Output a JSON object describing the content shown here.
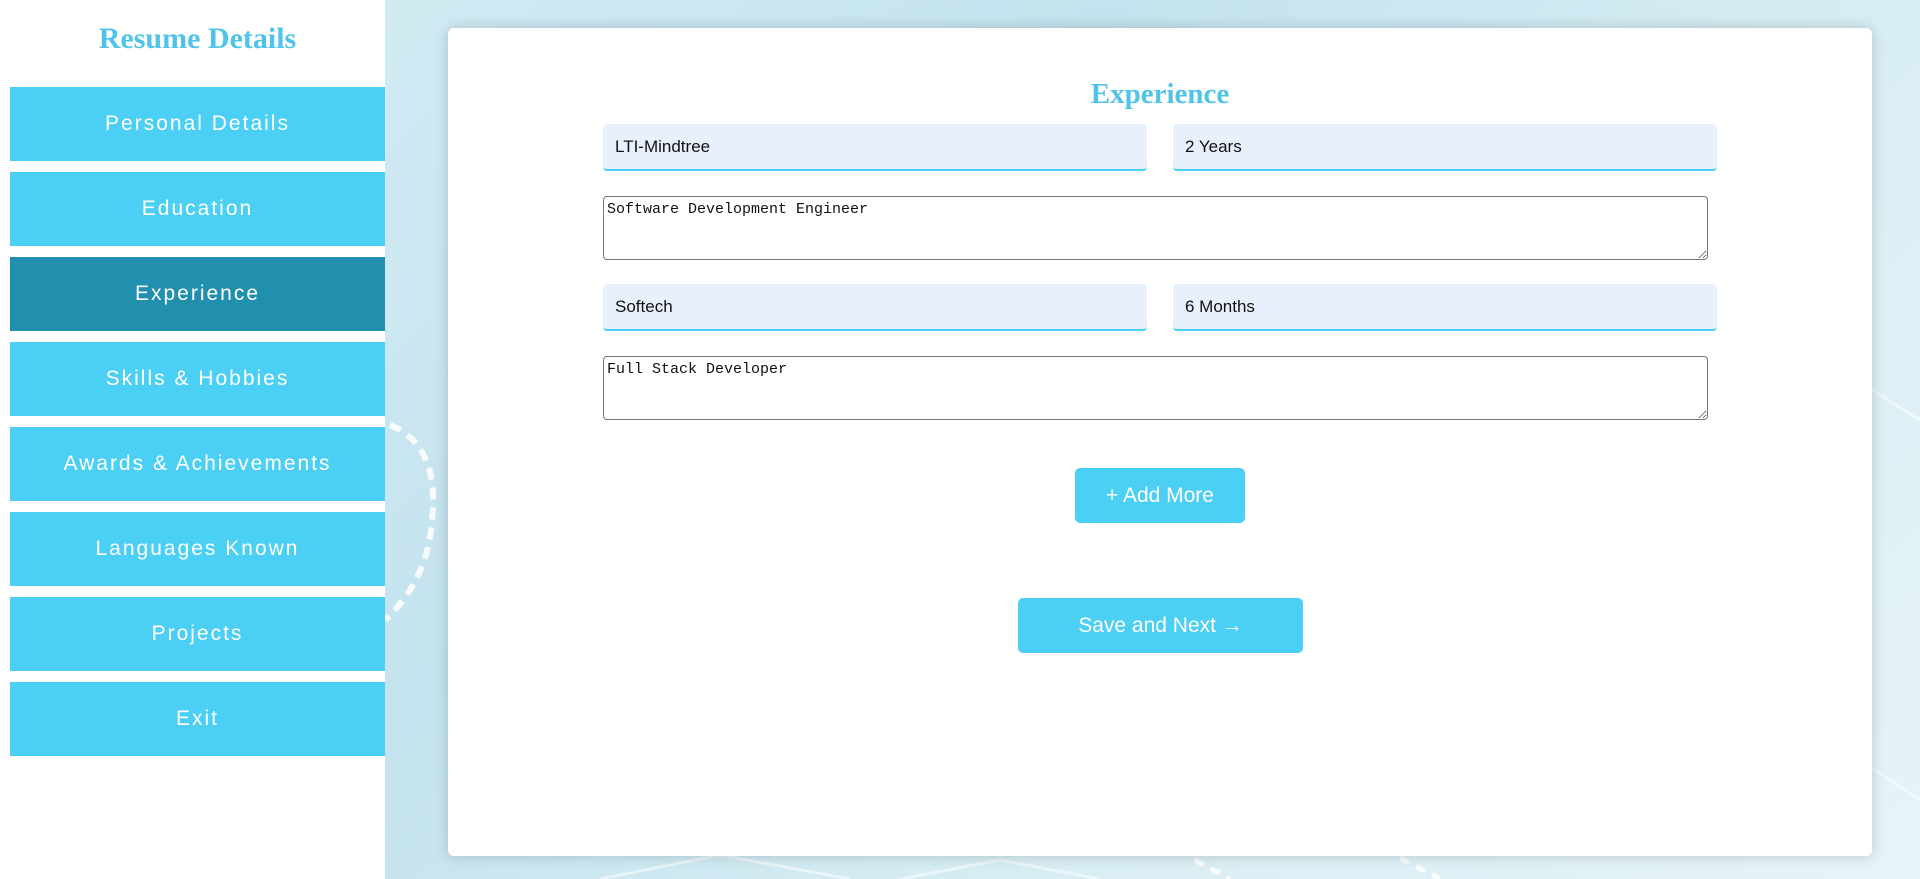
{
  "sidebar": {
    "title": "Resume Details",
    "items": [
      {
        "label": "Personal Details",
        "active": false
      },
      {
        "label": "Education",
        "active": false
      },
      {
        "label": "Experience",
        "active": true
      },
      {
        "label": "Skills & Hobbies",
        "active": false
      },
      {
        "label": "Awards & Achievements",
        "active": false
      },
      {
        "label": "Languages Known",
        "active": false
      },
      {
        "label": "Projects",
        "active": false
      },
      {
        "label": "Exit",
        "active": false
      }
    ]
  },
  "main": {
    "title": "Experience",
    "entries": [
      {
        "company": "LTI-Mindtree",
        "duration": "2 Years",
        "role": "Software Development Engineer"
      },
      {
        "company": "Softech",
        "duration": "6 Months",
        "role": "Full Stack Developer"
      }
    ],
    "add_more_label": "+ Add More",
    "save_next_label": "Save and Next →"
  },
  "colors": {
    "accent": "#4ccff4",
    "accent_active": "#218fae",
    "title": "#4fc3e9",
    "input_bg": "#e8f0fe"
  }
}
